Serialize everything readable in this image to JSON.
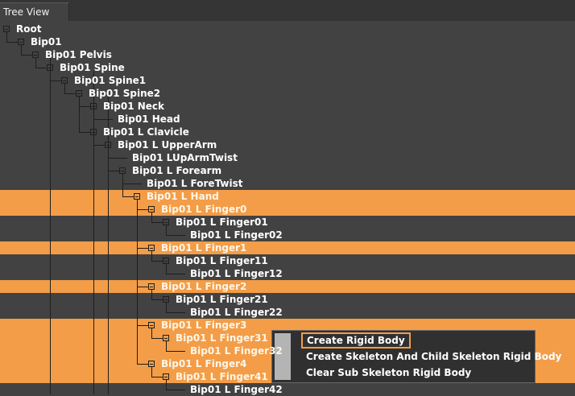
{
  "window": {
    "tab_title": "Tree View"
  },
  "tree": [
    {
      "label": "Root",
      "depth": 0,
      "selected": false,
      "last": true,
      "expanded": true
    },
    {
      "label": "Bip01",
      "depth": 1,
      "selected": false,
      "last": true,
      "expanded": true
    },
    {
      "label": "Bip01 Pelvis",
      "depth": 2,
      "selected": false,
      "last": true,
      "expanded": true
    },
    {
      "label": "Bip01 Spine",
      "depth": 3,
      "selected": false,
      "last": true,
      "expanded": true
    },
    {
      "label": "Bip01 Spine1",
      "depth": 4,
      "selected": false,
      "last": true,
      "expanded": true
    },
    {
      "label": "Bip01 Spine2",
      "depth": 5,
      "selected": false,
      "last": true,
      "expanded": true
    },
    {
      "label": "Bip01 Neck",
      "depth": 6,
      "selected": false,
      "last": false,
      "expanded": true
    },
    {
      "label": "Bip01 Head",
      "depth": 7,
      "selected": false,
      "last": true,
      "expanded": false
    },
    {
      "label": "Bip01 L Clavicle",
      "depth": 6,
      "selected": false,
      "last": false,
      "expanded": true
    },
    {
      "label": "Bip01 L UpperArm",
      "depth": 7,
      "selected": false,
      "last": true,
      "expanded": true
    },
    {
      "label": "Bip01 LUpArmTwist",
      "depth": 8,
      "selected": false,
      "last": false,
      "expanded": false
    },
    {
      "label": "Bip01 L Forearm",
      "depth": 8,
      "selected": false,
      "last": true,
      "expanded": true
    },
    {
      "label": "Bip01 L ForeTwist",
      "depth": 9,
      "selected": false,
      "last": false,
      "expanded": false
    },
    {
      "label": "Bip01 L Hand",
      "depth": 9,
      "selected": true,
      "last": true,
      "expanded": true
    },
    {
      "label": "Bip01 L Finger0",
      "depth": 10,
      "selected": true,
      "last": false,
      "expanded": true
    },
    {
      "label": "Bip01 L Finger01",
      "depth": 11,
      "selected": false,
      "last": true,
      "expanded": true
    },
    {
      "label": "Bip01 L Finger02",
      "depth": 12,
      "selected": false,
      "last": true,
      "expanded": false
    },
    {
      "label": "Bip01 L Finger1",
      "depth": 10,
      "selected": true,
      "last": false,
      "expanded": true
    },
    {
      "label": "Bip01 L Finger11",
      "depth": 11,
      "selected": false,
      "last": true,
      "expanded": true
    },
    {
      "label": "Bip01 L Finger12",
      "depth": 12,
      "selected": false,
      "last": true,
      "expanded": false
    },
    {
      "label": "Bip01 L Finger2",
      "depth": 10,
      "selected": true,
      "last": false,
      "expanded": true
    },
    {
      "label": "Bip01 L Finger21",
      "depth": 11,
      "selected": false,
      "last": true,
      "expanded": true
    },
    {
      "label": "Bip01 L Finger22",
      "depth": 12,
      "selected": false,
      "last": true,
      "expanded": false
    },
    {
      "label": "Bip01 L Finger3",
      "depth": 10,
      "selected": true,
      "last": false,
      "expanded": true
    },
    {
      "label": "Bip01 L Finger31",
      "depth": 11,
      "selected": true,
      "last": true,
      "expanded": true
    },
    {
      "label": "Bip01 L Finger32",
      "depth": 12,
      "selected": true,
      "last": true,
      "expanded": false
    },
    {
      "label": "Bip01 L Finger4",
      "depth": 10,
      "selected": true,
      "last": true,
      "expanded": true
    },
    {
      "label": "Bip01 L Finger41",
      "depth": 11,
      "selected": true,
      "last": true,
      "expanded": true
    },
    {
      "label": "Bip01 L Finger42",
      "depth": 12,
      "selected": false,
      "last": true,
      "expanded": false
    }
  ],
  "context_menu": {
    "items": [
      {
        "label": "Create Rigid Body",
        "highlighted": true
      },
      {
        "label": "Create Skeleton And Child Skeleton Rigid Body",
        "highlighted": false
      },
      {
        "label": "Clear Sub Skeleton Rigid Body",
        "highlighted": false
      }
    ]
  },
  "colors": {
    "background": "#424242",
    "selection": "#f39d48",
    "menu_background": "#303030",
    "menu_highlight_border": "#f39d48"
  }
}
